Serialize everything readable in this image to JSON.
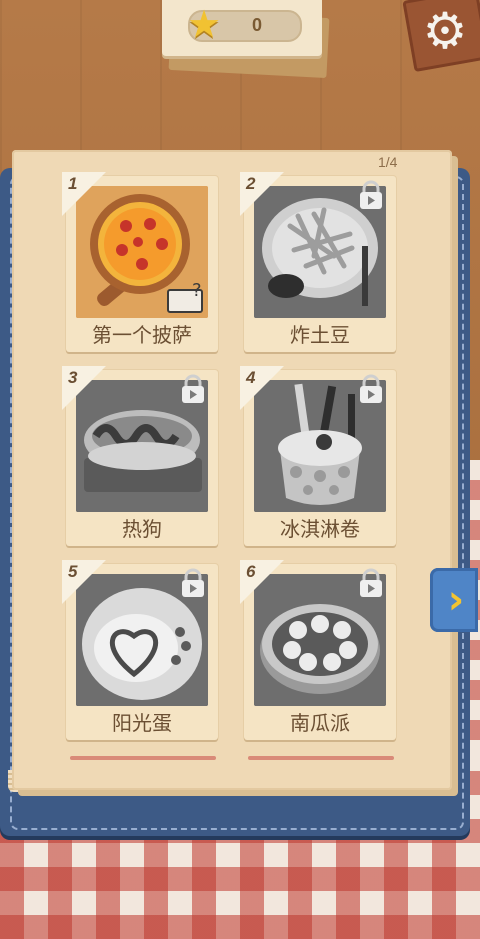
{
  "hud": {
    "score": "0",
    "star_icon": "★",
    "settings_icon": "⚙"
  },
  "book": {
    "page_indicator": "1/4",
    "next_icon": "›"
  },
  "recipes": [
    {
      "number": "1",
      "label": "第一个披萨",
      "locked": false
    },
    {
      "number": "2",
      "label": "炸土豆",
      "locked": true
    },
    {
      "number": "3",
      "label": "热狗",
      "locked": true
    },
    {
      "number": "4",
      "label": "冰淇淋卷",
      "locked": true
    },
    {
      "number": "5",
      "label": "阳光蛋",
      "locked": true
    },
    {
      "number": "6",
      "label": "南瓜派",
      "locked": true
    }
  ],
  "colors": {
    "book_cover": "#3d5a86",
    "page": "#efd9b5",
    "accent_next": "#4f85c7",
    "chevron": "#f3c430"
  }
}
